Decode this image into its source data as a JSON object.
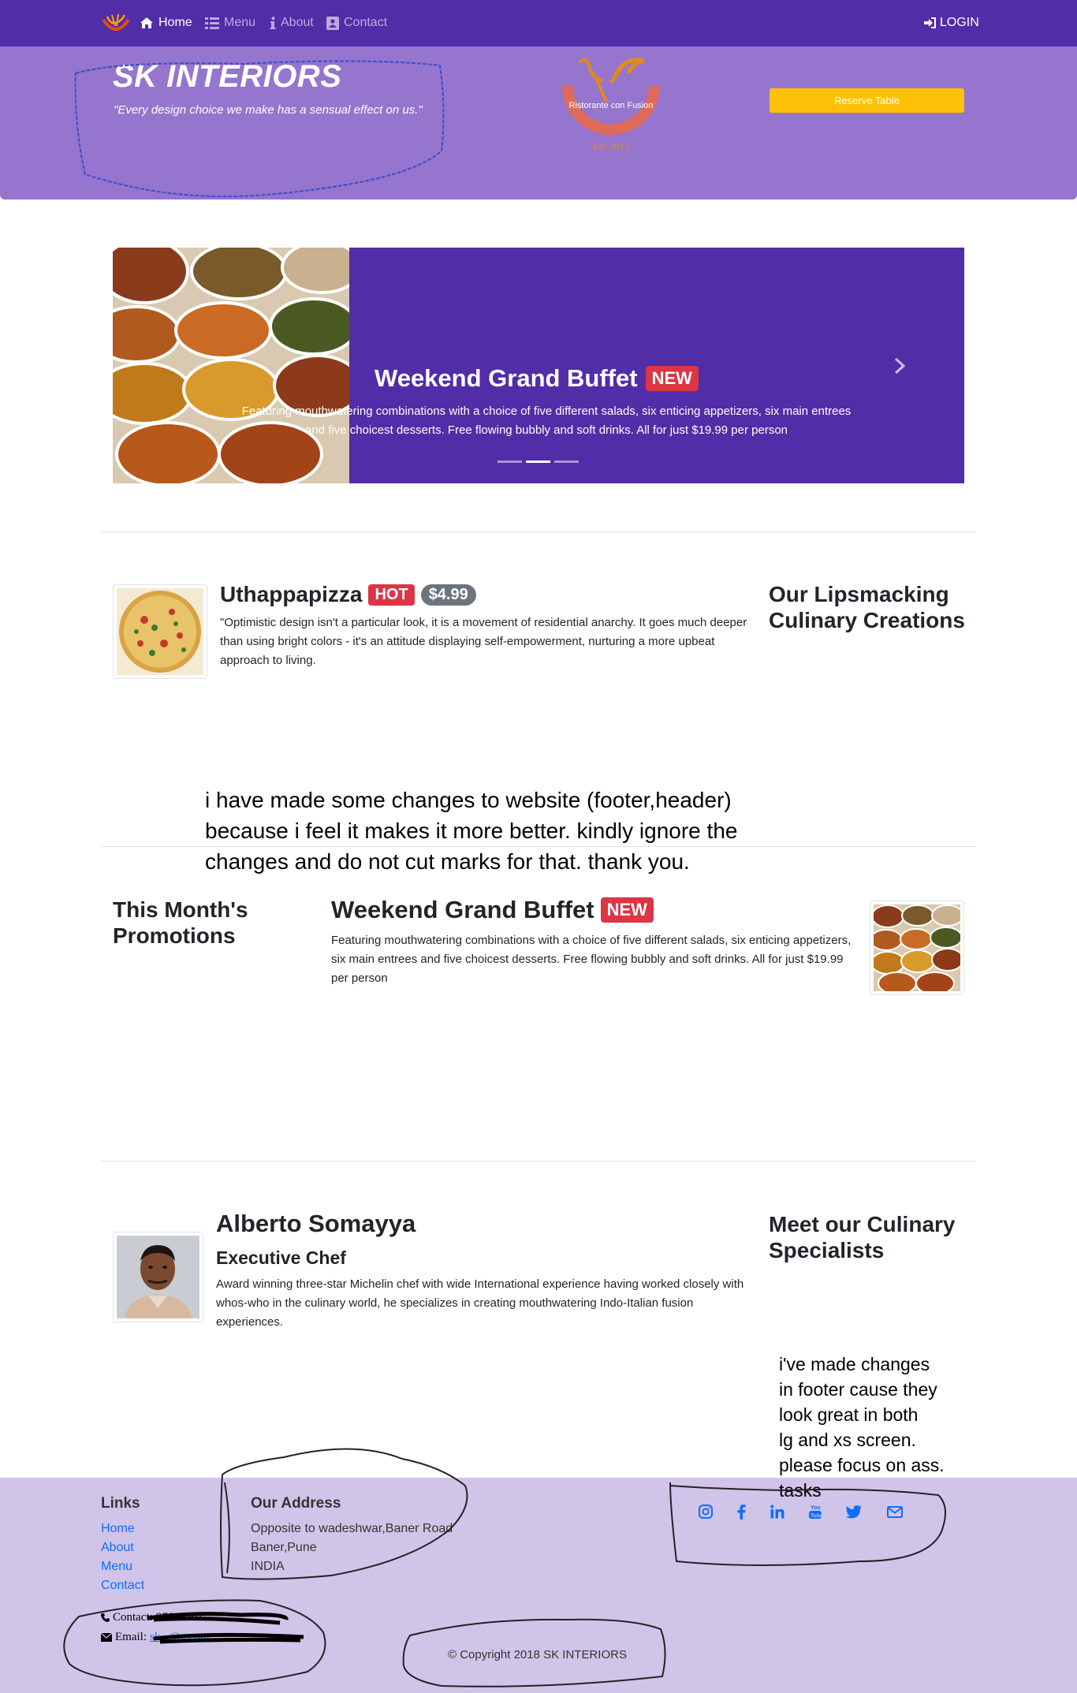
{
  "nav": {
    "items": [
      {
        "label": "Home",
        "icon": "home-icon",
        "active": true
      },
      {
        "label": "Menu",
        "icon": "list-icon",
        "active": false
      },
      {
        "label": "About",
        "icon": "info-icon",
        "active": false
      },
      {
        "label": "Contact",
        "icon": "address-card-icon",
        "active": false
      }
    ],
    "login": "LOGIN"
  },
  "header": {
    "brand": "SK INTERIORS",
    "tagline": "\"Every design choice we make has a sensual effect on us.\"",
    "logo_text": "Ristorante con Fusion",
    "logo_year": "Est. 2013",
    "reserve_button": "Reserve Table"
  },
  "carousel": {
    "title": "Weekend Grand Buffet",
    "badge": "NEW",
    "caption": "Featuring mouthwatering combinations with a choice of five different salads, six enticing appetizers, six main entrees and five choicest desserts. Free flowing bubbly and soft drinks. All for just $19.99 per person",
    "slide_count": 3,
    "active_slide": 2
  },
  "dish": {
    "name": "Uthappapizza",
    "hot_badge": "HOT",
    "price": "$4.99",
    "description": "\"Optimistic design isn't a particular look, it is a movement of residential anarchy. It goes much deeper than using bright colors - it's an attitude displaying self-empowerment, nurturing a more upbeat approach to living.",
    "section_heading_line1": "Our Lipsmacking",
    "section_heading_line2": "Culinary Creations"
  },
  "note1": {
    "line1": "i have made some changes to website (footer,header)",
    "line2": "because i feel it makes it more better. kindly ignore the",
    "line3": "changes and do not cut marks for that. thank you."
  },
  "promo": {
    "section_heading_line1": "This Month's",
    "section_heading_line2": "Promotions",
    "title": "Weekend Grand Buffet",
    "badge": "NEW",
    "description": "Featuring mouthwatering combinations with a choice of five different salads, six enticing appetizers, six main entrees and five choicest desserts. Free flowing bubbly and soft drinks. All for just $19.99 per person"
  },
  "chef": {
    "name": "Alberto Somayya",
    "role": "Executive Chef",
    "bio": "Award winning three-star Michelin chef with wide International experience having worked closely with whos-who in the culinary world, he specializes in creating mouthwatering Indo-Italian fusion experiences.",
    "section_heading_line1": "Meet our Culinary",
    "section_heading_line2": "Specialists"
  },
  "note2": {
    "lines": [
      "i've made changes",
      "in footer cause they",
      "look great in both",
      "lg and xs screen.",
      "please focus on ass.",
      "tasks"
    ]
  },
  "footer": {
    "links_heading": "Links",
    "links": [
      "Home",
      "About",
      "Menu",
      "Contact"
    ],
    "address_heading": "Our Address",
    "address_lines": [
      "Opposite to wadeshwar,Baner Road",
      "Baner,Pune",
      "INDIA"
    ],
    "contact_label": "Contact:",
    "contact_value": "97665201...",
    "email_label": "Email:",
    "email_value": "sk...@...com",
    "social_icons": [
      "instagram-icon",
      "facebook-icon",
      "linkedin-icon",
      "youtube-icon",
      "twitter-icon",
      "envelope-icon"
    ],
    "copyright": "© Copyright 2018 SK INTERIORS"
  },
  "colors": {
    "navbar": "#512da8",
    "jumbotron": "#9575cd",
    "footer": "#d1c4e9",
    "accent": "#ffc107",
    "badge_red": "#dc3545",
    "link": "#0d6efd"
  }
}
